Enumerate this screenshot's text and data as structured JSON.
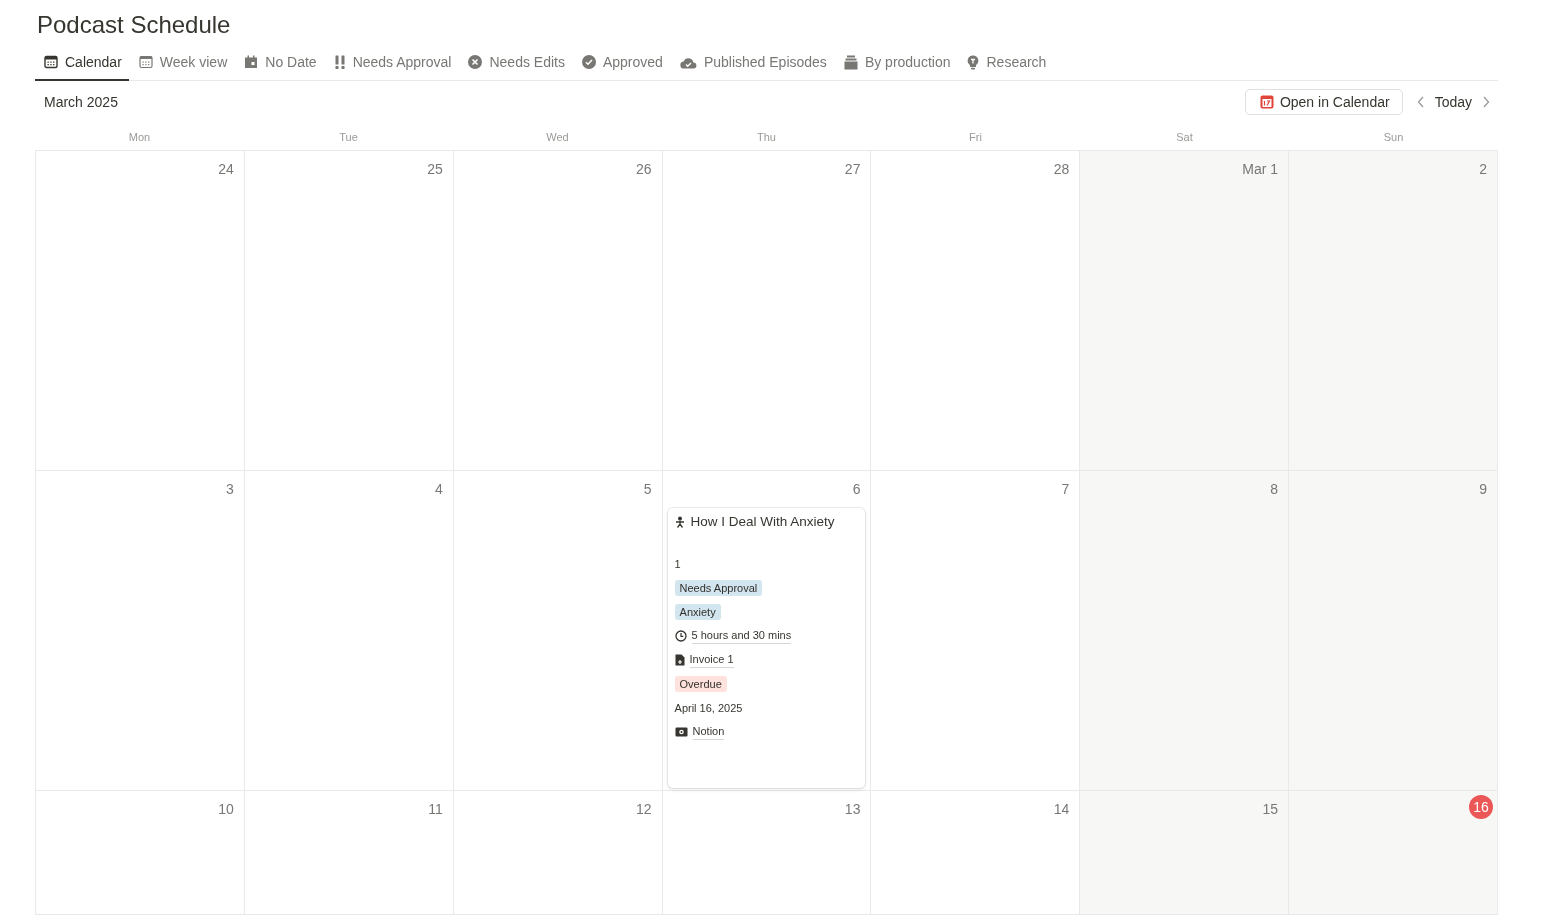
{
  "page_title": "Podcast Schedule",
  "tabs": [
    {
      "label": "Calendar",
      "selected": true
    },
    {
      "label": "Week view",
      "selected": false
    },
    {
      "label": "No Date",
      "selected": false
    },
    {
      "label": "Needs Approval",
      "selected": false
    },
    {
      "label": "Needs Edits",
      "selected": false
    },
    {
      "label": "Approved",
      "selected": false
    },
    {
      "label": "Published Episodes",
      "selected": false
    },
    {
      "label": "By production",
      "selected": false
    },
    {
      "label": "Research",
      "selected": false
    }
  ],
  "toolbar": {
    "month": "March 2025",
    "open_button": "Open in Calendar",
    "today_button": "Today"
  },
  "weekdays": [
    "Mon",
    "Tue",
    "Wed",
    "Thu",
    "Fri",
    "Sat",
    "Sun"
  ],
  "weeks": [
    {
      "days": [
        {
          "label": "24",
          "today": false
        },
        {
          "label": "25",
          "today": false
        },
        {
          "label": "26",
          "today": false
        },
        {
          "label": "27",
          "today": false
        },
        {
          "label": "28",
          "today": false
        },
        {
          "label": "Mar 1",
          "today": false
        },
        {
          "label": "2",
          "today": false
        }
      ]
    },
    {
      "days": [
        {
          "label": "3",
          "today": false
        },
        {
          "label": "4",
          "today": false
        },
        {
          "label": "5",
          "today": false
        },
        {
          "label": "6",
          "today": false,
          "events": [
            {
              "title": "How I Deal With Anxiety",
              "properties": [
                {
                  "kind": "text",
                  "text": "1"
                },
                {
                  "kind": "tag",
                  "text": "Needs Approval",
                  "color": "#d3e5ef"
                },
                {
                  "kind": "tag",
                  "text": "Anxiety",
                  "color": "#d3e5ef"
                },
                {
                  "kind": "duration",
                  "text": "5 hours and 30 mins"
                },
                {
                  "kind": "file",
                  "text": "Invoice 1"
                },
                {
                  "kind": "tag",
                  "text": "Overdue",
                  "color": "#ffe2dd"
                },
                {
                  "kind": "text",
                  "text": "April 16, 2025"
                },
                {
                  "kind": "url",
                  "text": "Notion"
                }
              ]
            }
          ]
        },
        {
          "label": "7",
          "today": false
        },
        {
          "label": "8",
          "today": false
        },
        {
          "label": "9",
          "today": false
        }
      ]
    },
    {
      "days": [
        {
          "label": "10",
          "today": false
        },
        {
          "label": "11",
          "today": false
        },
        {
          "label": "12",
          "today": false
        },
        {
          "label": "13",
          "today": false
        },
        {
          "label": "14",
          "today": false
        },
        {
          "label": "15",
          "today": false
        },
        {
          "label": "16",
          "today": true
        }
      ]
    }
  ]
}
